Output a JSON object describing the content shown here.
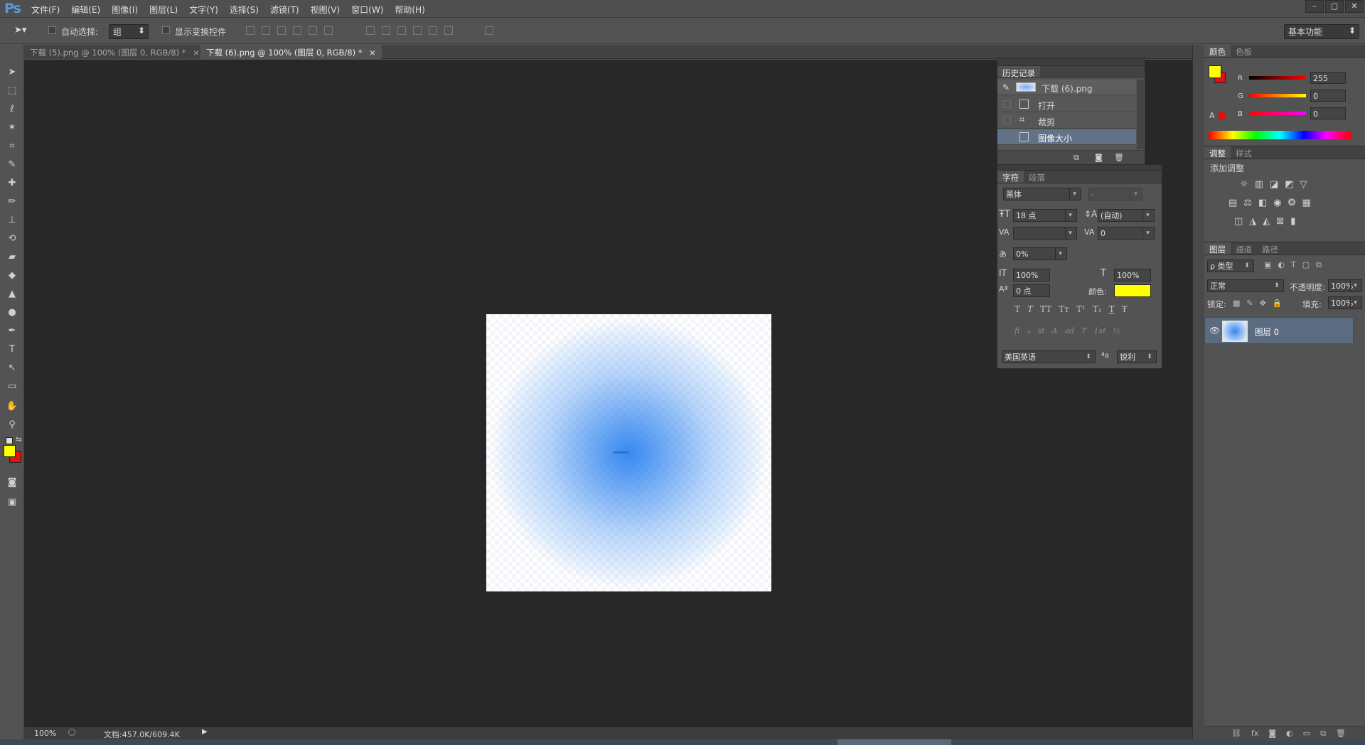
{
  "app": {
    "logo": "Ps"
  },
  "menu": [
    "文件(F)",
    "编辑(E)",
    "图像(I)",
    "图层(L)",
    "文字(Y)",
    "选择(S)",
    "滤镜(T)",
    "视图(V)",
    "窗口(W)",
    "帮助(H)"
  ],
  "window_buttons": [
    "–",
    "▢",
    "✕"
  ],
  "options": {
    "auto_select_label": "自动选择:",
    "auto_select_value": "组",
    "show_transform_label": "显示变换控件",
    "workspace": "基本功能"
  },
  "tabs": [
    {
      "label": "下载 (5).png @ 100% (图层 0, RGB/8) *",
      "close": "×",
      "active": false
    },
    {
      "label": "下载 (6).png @ 100% (图层 0, RGB/8) *",
      "close": "×",
      "active": true
    }
  ],
  "status": {
    "zoom": "100%",
    "doc": "文档:457.0K/609.4K"
  },
  "history": {
    "title": "历史记录",
    "snapshot": "下载 (6).png",
    "items": [
      "打开",
      "裁剪",
      "图像大小"
    ]
  },
  "character": {
    "tabs": [
      "字符",
      "段落"
    ],
    "font_family": "黑体",
    "font_style": "-",
    "size": "18 点",
    "leading": "(自动)",
    "kerning": "",
    "tracking": "0",
    "scale_pct": "0%",
    "vscale": "100%",
    "hscale": "100%",
    "baseline": "0 点",
    "color_label": "颜色:",
    "color": "#ffff00",
    "style_buttons": [
      "T",
      "T",
      "TT",
      "Tт",
      "T¹",
      "T₁",
      "T",
      "Ŧ"
    ],
    "opentype_buttons": [
      "fi",
      "ℴ",
      "st",
      "A",
      "ad",
      "T",
      "1st",
      "½"
    ],
    "language": "美国英语",
    "aa_label": "ªa",
    "antialias": "锐利"
  },
  "color_panel": {
    "tabs": [
      "颜色",
      "色板"
    ],
    "channels": [
      {
        "label": "R",
        "value": "255"
      },
      {
        "label": "G",
        "value": "0"
      },
      {
        "label": "B",
        "value": "0"
      }
    ],
    "foreground": "#ffff00",
    "background": "#e01010"
  },
  "adjustments": {
    "tabs": [
      "调整",
      "样式"
    ],
    "title": "添加调整"
  },
  "layers": {
    "tabs": [
      "图层",
      "通道",
      "路径"
    ],
    "filter_label": "ρ 类型",
    "blend_mode": "正常",
    "opacity_label": "不透明度:",
    "opacity": "100%",
    "lock_label": "锁定:",
    "fill_label": "填充:",
    "fill": "100%",
    "items": [
      {
        "name": "图层 0"
      }
    ]
  }
}
